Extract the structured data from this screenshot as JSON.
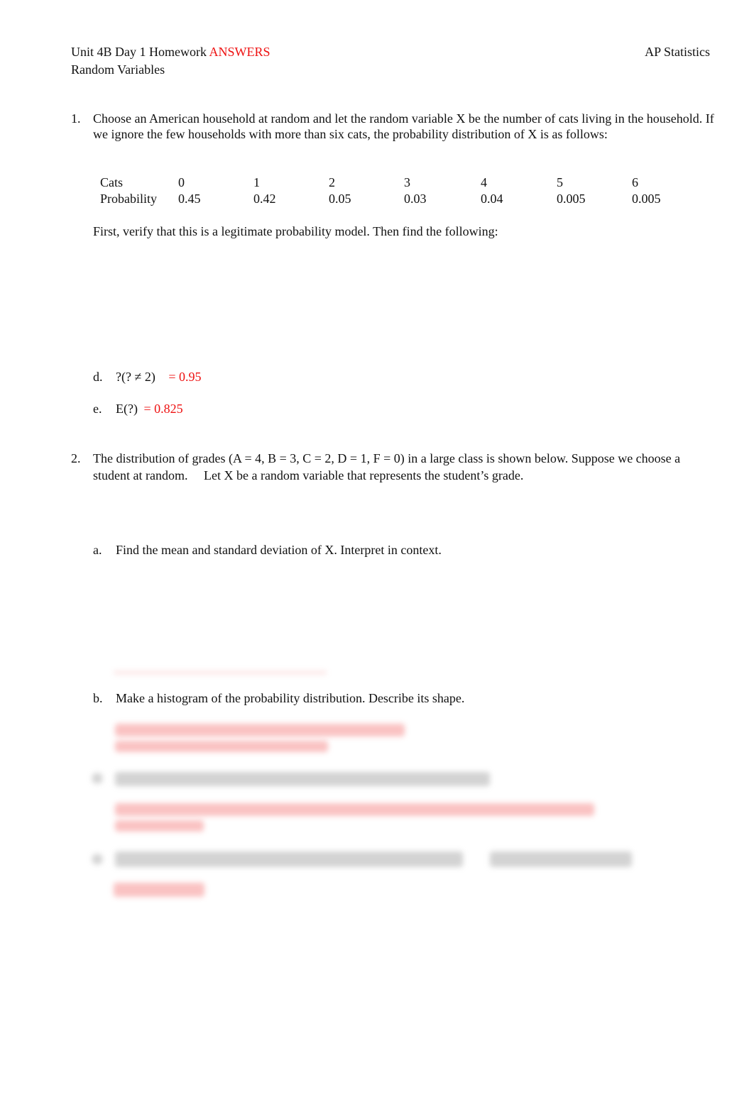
{
  "header": {
    "title_prefix": "Unit 4B Day 1 Homework",
    "title_answers": "ANSWERS",
    "subtitle": "Random Variables",
    "course": "AP Statistics"
  },
  "colors": {
    "answer": "#ee1111",
    "text": "#111111"
  },
  "question1": {
    "number": "1.",
    "text": "Choose an American household at random and let the random variable X be the number of cats living in the household. If we ignore the few households with more than six cats, the probability distribution of X is as follows:",
    "table": {
      "row_labels": [
        "Cats",
        "Probability"
      ],
      "cats": [
        "0",
        "1",
        "2",
        "3",
        "4",
        "5",
        "6"
      ],
      "probabilities": [
        "0.45",
        "0.42",
        "0.05",
        "0.03",
        "0.04",
        "0.005",
        "0.005"
      ]
    },
    "instruction": "First, verify that this is a legitimate probability model.  Then find the following:",
    "parts": [
      {
        "label": "d.",
        "expression": "?(? ≠ 2)",
        "answer": "= 0.95"
      },
      {
        "label": "e.",
        "expression": "E(?)",
        "answer": "= 0.825"
      }
    ]
  },
  "question2": {
    "number": "2.",
    "text_main": "The distribution of grades (A = 4, B = 3, C = 2, D = 1, F = 0) in a large class is shown below.  Suppose we choose a student at random.",
    "text_second": "Let X be a random variable that represents the student’s grade.",
    "parts": [
      {
        "label": "a.",
        "text": "Find the mean and standard deviation of X.  Interpret in context."
      },
      {
        "label": "b.",
        "text": "Make a histogram of the probability distribution.  Describe its shape."
      }
    ]
  }
}
